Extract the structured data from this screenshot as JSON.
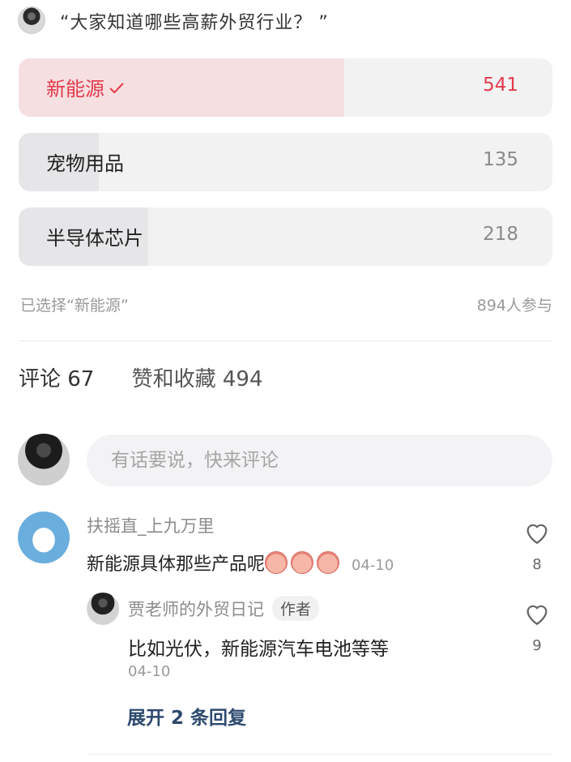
{
  "poll": {
    "question": "“大家知道哪些高薪外贸行业？ ”",
    "options": [
      {
        "label": "新能源",
        "count": "541",
        "share": 0.61,
        "selected": true
      },
      {
        "label": "宠物用品",
        "count": "135",
        "share": 0.15,
        "selected": false
      },
      {
        "label": "半导体芯片",
        "count": "218",
        "share": 0.24,
        "selected": false
      }
    ],
    "selected_text": "已选择“新能源”",
    "participants": "894人参与",
    "selected_color": "#e33a4a"
  },
  "tabs": {
    "comments": "评论 67",
    "likes": "赞和收藏 494"
  },
  "comment_box": {
    "placeholder": "有话要说，快来评论"
  },
  "comments": [
    {
      "username": "扶摇直_上九万里",
      "text": "新能源具体那些产品呢",
      "date": "04-10",
      "likes": "8",
      "emoji_icons": [
        "crying-face-icon",
        "crying-face-icon",
        "crying-face-icon"
      ],
      "reply": {
        "username": "贾老师的外贸日记",
        "badge": "作者",
        "text": "比如光伏，新能源汽车电池等等",
        "date": "04-10",
        "likes": "9"
      },
      "expand_label": "展开 2 条回复"
    }
  ]
}
